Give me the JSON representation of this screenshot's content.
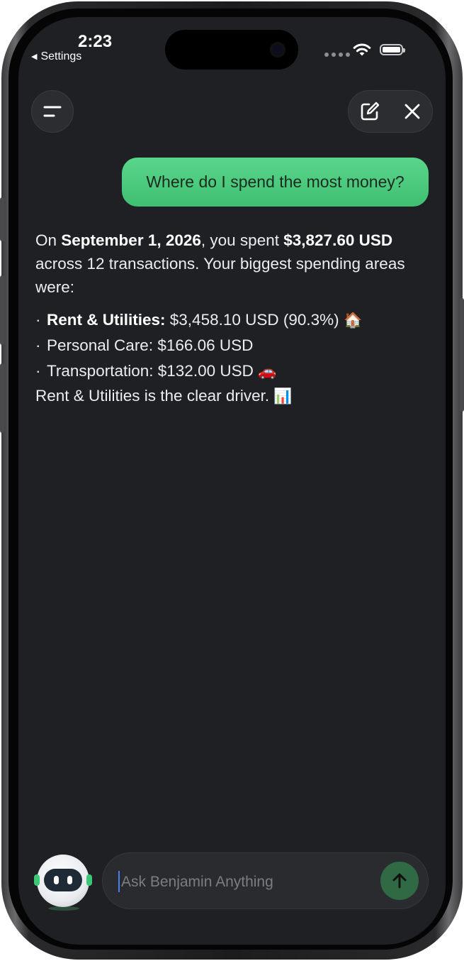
{
  "status_bar": {
    "time": "2:23",
    "back_label": "Settings"
  },
  "header": {
    "menu_icon": "hamburger-icon",
    "compose_icon": "compose-icon",
    "close_icon": "close-icon"
  },
  "conversation": {
    "user_message": "Where do I spend the most money?",
    "reply": {
      "intro_prefix": "On",
      "date": "September 1, 2026",
      "intro_mid": ", you spent",
      "total": "$3,827.60 USD",
      "intro_suffix": "across 12 transactions. Your biggest spending areas were:",
      "bullets": [
        {
          "label": "Rent & Utilities:",
          "value": "$3,458.10 USD (90.3%)",
          "emoji": "🏠"
        },
        {
          "label": "Personal Care:",
          "value": "$166.06 USD",
          "emoji": ""
        },
        {
          "label": "Transportation:",
          "value": "$132.00 USD",
          "emoji": "🚗"
        }
      ],
      "closing": "Rent & Utilities is the clear driver.",
      "closing_emoji": "📊"
    }
  },
  "composer": {
    "placeholder": "Ask Benjamin Anything",
    "send_icon": "arrow-up-icon",
    "avatar_icon": "robot-avatar-icon"
  },
  "colors": {
    "background": "#1f2023",
    "user_bubble": "#4cc97e",
    "send_button": "#2f6a44"
  }
}
